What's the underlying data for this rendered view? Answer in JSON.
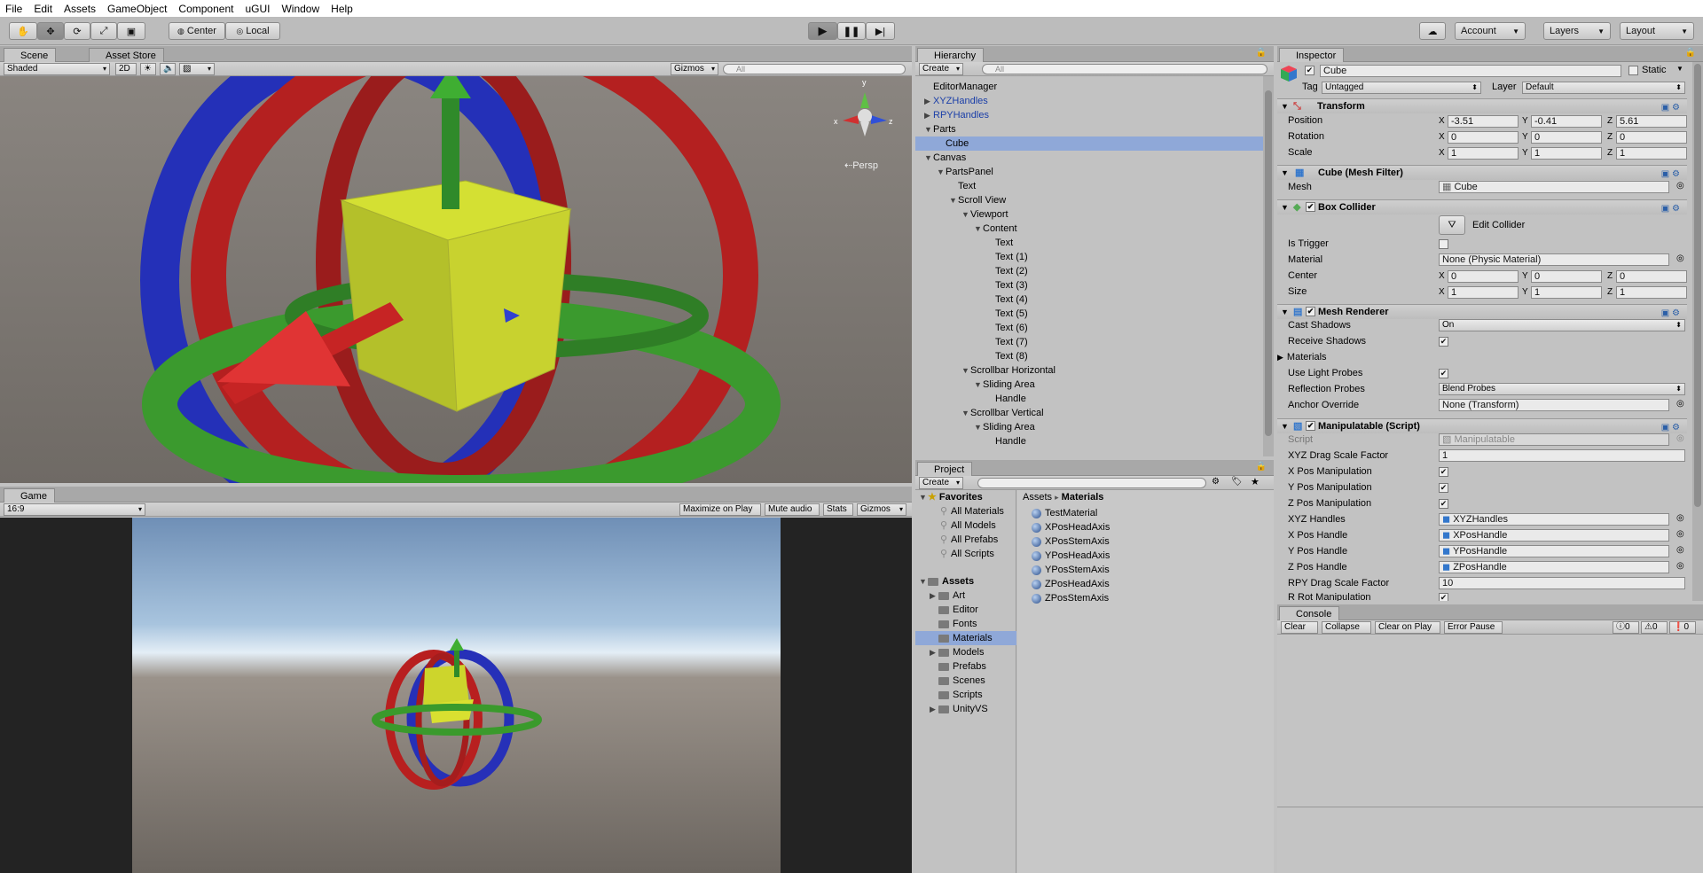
{
  "menu": [
    "File",
    "Edit",
    "Assets",
    "GameObject",
    "Component",
    "uGUI",
    "Window",
    "Help"
  ],
  "toolbar": {
    "pivot": "Center",
    "space": "Local",
    "account": "Account",
    "layers": "Layers",
    "layout": "Layout"
  },
  "scene": {
    "tab_scene": "Scene",
    "tab_asset_store": "Asset Store",
    "shading": "Shaded",
    "mode2d": "2D",
    "gizmos": "Gizmos",
    "search_placeholder": "All",
    "persp": "Persp",
    "gizmo_axes": [
      "x",
      "y",
      "z"
    ]
  },
  "game": {
    "tab": "Game",
    "aspect": "16:9",
    "maximize": "Maximize on Play",
    "mute": "Mute audio",
    "stats": "Stats",
    "gizmos": "Gizmos"
  },
  "hierarchy": {
    "tab": "Hierarchy",
    "create": "Create",
    "search_placeholder": "All",
    "items": [
      {
        "label": "EditorManager",
        "indent": 0,
        "arrow": "",
        "blue": false
      },
      {
        "label": "XYZHandles",
        "indent": 0,
        "arrow": "▶",
        "blue": true
      },
      {
        "label": "RPYHandles",
        "indent": 0,
        "arrow": "▶",
        "blue": true
      },
      {
        "label": "Parts",
        "indent": 0,
        "arrow": "▼",
        "blue": false
      },
      {
        "label": "Cube",
        "indent": 1,
        "arrow": "",
        "blue": false,
        "selected": true
      },
      {
        "label": "Canvas",
        "indent": 0,
        "arrow": "▼",
        "blue": false
      },
      {
        "label": "PartsPanel",
        "indent": 1,
        "arrow": "▼",
        "blue": false
      },
      {
        "label": "Text",
        "indent": 2,
        "arrow": "",
        "blue": false
      },
      {
        "label": "Scroll View",
        "indent": 2,
        "arrow": "▼",
        "blue": false
      },
      {
        "label": "Viewport",
        "indent": 3,
        "arrow": "▼",
        "blue": false
      },
      {
        "label": "Content",
        "indent": 4,
        "arrow": "▼",
        "blue": false
      },
      {
        "label": "Text",
        "indent": 5,
        "arrow": "",
        "blue": false
      },
      {
        "label": "Text (1)",
        "indent": 5,
        "arrow": "",
        "blue": false
      },
      {
        "label": "Text (2)",
        "indent": 5,
        "arrow": "",
        "blue": false
      },
      {
        "label": "Text (3)",
        "indent": 5,
        "arrow": "",
        "blue": false
      },
      {
        "label": "Text (4)",
        "indent": 5,
        "arrow": "",
        "blue": false
      },
      {
        "label": "Text (5)",
        "indent": 5,
        "arrow": "",
        "blue": false
      },
      {
        "label": "Text (6)",
        "indent": 5,
        "arrow": "",
        "blue": false
      },
      {
        "label": "Text (7)",
        "indent": 5,
        "arrow": "",
        "blue": false
      },
      {
        "label": "Text (8)",
        "indent": 5,
        "arrow": "",
        "blue": false
      },
      {
        "label": "Scrollbar Horizontal",
        "indent": 3,
        "arrow": "▼",
        "blue": false
      },
      {
        "label": "Sliding Area",
        "indent": 4,
        "arrow": "▼",
        "blue": false
      },
      {
        "label": "Handle",
        "indent": 5,
        "arrow": "",
        "blue": false
      },
      {
        "label": "Scrollbar Vertical",
        "indent": 3,
        "arrow": "▼",
        "blue": false
      },
      {
        "label": "Sliding Area",
        "indent": 4,
        "arrow": "▼",
        "blue": false
      },
      {
        "label": "Handle",
        "indent": 5,
        "arrow": "",
        "blue": false
      }
    ]
  },
  "project": {
    "tab": "Project",
    "create": "Create",
    "favorites_label": "Favorites",
    "favorites": [
      "All Materials",
      "All Models",
      "All Prefabs",
      "All Scripts"
    ],
    "assets_label": "Assets",
    "folders": [
      {
        "label": "Art",
        "arrow": "▶"
      },
      {
        "label": "Editor",
        "arrow": ""
      },
      {
        "label": "Fonts",
        "arrow": ""
      },
      {
        "label": "Materials",
        "arrow": "",
        "selected": true
      },
      {
        "label": "Models",
        "arrow": "▶"
      },
      {
        "label": "Prefabs",
        "arrow": ""
      },
      {
        "label": "Scenes",
        "arrow": ""
      },
      {
        "label": "Scripts",
        "arrow": ""
      },
      {
        "label": "UnityVS",
        "arrow": "▶"
      }
    ],
    "breadcrumb_root": "Assets",
    "breadcrumb_sep": "▸",
    "breadcrumb_current": "Materials",
    "files": [
      "TestMaterial",
      "XPosHeadAxis",
      "XPosStemAxis",
      "YPosHeadAxis",
      "YPosStemAxis",
      "ZPosHeadAxis",
      "ZPosStemAxis"
    ]
  },
  "inspector": {
    "tab": "Inspector",
    "name": "Cube",
    "static": "Static",
    "tag_label": "Tag",
    "tag_value": "Untagged",
    "layer_label": "Layer",
    "layer_value": "Default",
    "transform": {
      "title": "Transform",
      "position_label": "Position",
      "px": "-3.51",
      "py": "-0.41",
      "pz": "5.61",
      "rotation_label": "Rotation",
      "rx": "0",
      "ry": "0",
      "rz": "0",
      "scale_label": "Scale",
      "sx": "1",
      "sy": "1",
      "sz": "1"
    },
    "mesh_filter": {
      "title": "Cube (Mesh Filter)",
      "mesh_label": "Mesh",
      "mesh_value": "Cube"
    },
    "box_collider": {
      "title": "Box Collider",
      "edit_collider": "Edit Collider",
      "is_trigger": "Is Trigger",
      "material_label": "Material",
      "material_value": "None (Physic Material)",
      "center_label": "Center",
      "cx": "0",
      "cy": "0",
      "cz": "0",
      "size_label": "Size",
      "szx": "1",
      "szy": "1",
      "szz": "1"
    },
    "mesh_renderer": {
      "title": "Mesh Renderer",
      "cast_shadows": "Cast Shadows",
      "cast_shadows_value": "On",
      "receive_shadows": "Receive Shadows",
      "materials": "Materials",
      "use_light_probes": "Use Light Probes",
      "reflection_probes": "Reflection Probes",
      "reflection_probes_value": "Blend Probes",
      "anchor_override": "Anchor Override",
      "anchor_override_value": "None (Transform)"
    },
    "manipulatable": {
      "title": "Manipulatable (Script)",
      "script_label": "Script",
      "script_value": "Manipulatable",
      "xyz_drag_label": "XYZ Drag Scale Factor",
      "xyz_drag_value": "1",
      "x_pos_label": "X Pos Manipulation",
      "y_pos_label": "Y Pos Manipulation",
      "z_pos_label": "Z Pos Manipulation",
      "xyz_handles_label": "XYZ Handles",
      "xyz_handles_value": "XYZHandles",
      "x_handle_label": "X Pos Handle",
      "x_handle_value": "XPosHandle",
      "y_handle_label": "Y Pos Handle",
      "y_handle_value": "YPosHandle",
      "z_handle_label": "Z Pos Handle",
      "z_handle_value": "ZPosHandle",
      "rpy_drag_label": "RPY Drag Scale Factor",
      "rpy_drag_value": "10",
      "r_rot_label": "R Rot Manipulation"
    },
    "axis_x": "X",
    "axis_y": "Y",
    "axis_z": "Z"
  },
  "console": {
    "tab": "Console",
    "clear": "Clear",
    "collapse": "Collapse",
    "clear_on_play": "Clear on Play",
    "error_pause": "Error Pause",
    "info_count": "0",
    "warn_count": "0",
    "error_count": "0"
  }
}
